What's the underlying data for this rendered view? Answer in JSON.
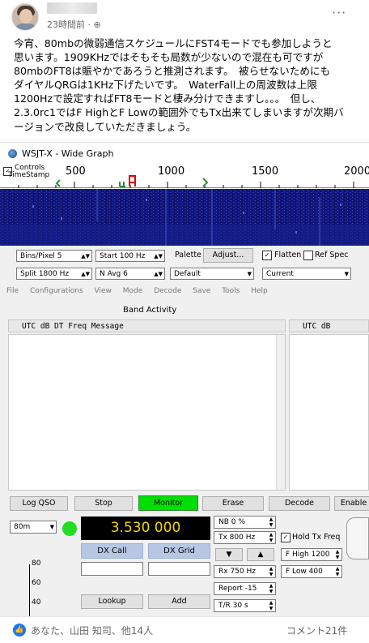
{
  "post": {
    "time": "23時間前 · ⊕",
    "more": "···",
    "body": "今宵、80mbの微弱通信スケジュールにFST4モードでも参加しようと\n思います。1909KHzではそもそも局数が少ないので混在も可ですが\n80mbのFT8は賑やかであろうと推測されます。　被らせないためにも\nダイヤルQRGは1KHz下げたいです。　WaterFall上の周波数は上限\n1200Hzで設定すればFT8モードと棲み分けできますし。。。　但し、\n2.3.0rc1ではF HighとF Lowの範囲外でもTx出来てしまいますが次期バ\nージョンで改良していただきましょう。"
  },
  "wide_graph": {
    "title": "WSJT-X - Wide Graph",
    "controls_label": "Controls",
    "timestamp_label": "TimeStamp",
    "scale_labels": [
      "500",
      "1000",
      "1500",
      "2000"
    ],
    "bins_pixel": "Bins/Pixel  5",
    "start": "Start  100 Hz",
    "palette_label": "Palette",
    "adjust_button": "Adjust...",
    "flatten_label": "Flatten",
    "ref_spec_label": "Ref Spec",
    "split": "Split  1800  Hz",
    "n_avg": "N Avg  6",
    "palette_value": "Default",
    "spectrum_value": "Current"
  },
  "main_window": {
    "menu": [
      "File",
      "Configurations",
      "View",
      "Mode",
      "Decode",
      "Save",
      "Tools",
      "Help"
    ],
    "band_activity_title": "Band Activity",
    "left_header": "UTC   dB   DT Freq     Message",
    "right_header": "UTC   dB",
    "buttons": {
      "log_qso": "Log QSO",
      "stop": "Stop",
      "monitor": "Monitor",
      "erase": "Erase",
      "decode": "Decode",
      "enable": "Enable"
    },
    "band": "80m",
    "frequency": "3.530 000",
    "dx_call": "DX Call",
    "dx_grid": "DX Grid",
    "lookup": "Lookup",
    "add": "Add",
    "nb": "NB  0 %",
    "tx": "Tx  800  Hz",
    "rx": "Rx  750  Hz",
    "report": "Report  -15",
    "tr": "T/R  30  s",
    "hold_tx_freq": "Hold Tx Freq",
    "f_high": "F High  1200",
    "f_low": "F Low   400",
    "meter_labels": [
      "80",
      "60",
      "40"
    ],
    "monitor_color": "#00e000",
    "freq_color": "#f5d700"
  },
  "footer": {
    "reactors": "あなた、山田 知司、他14人",
    "comments": "コメント21件"
  }
}
